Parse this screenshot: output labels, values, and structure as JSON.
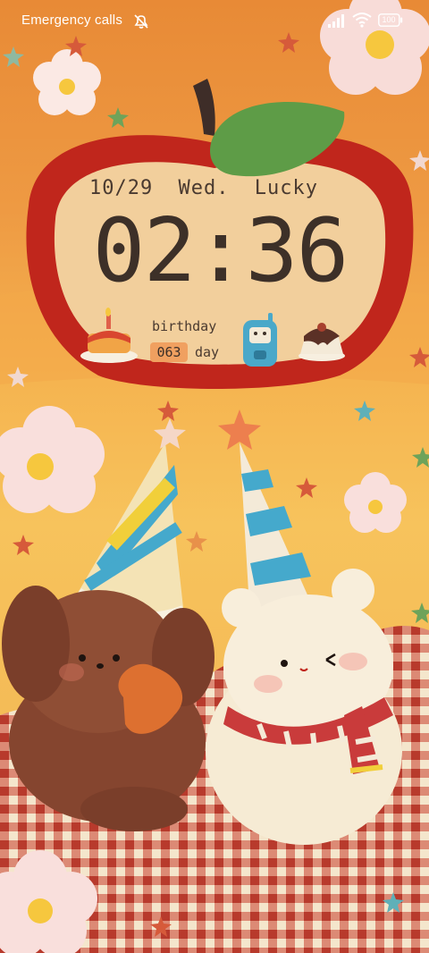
{
  "status_bar": {
    "carrier_text": "Emergency calls",
    "battery_level": "100",
    "icons": [
      "alarm-off-icon",
      "signal-icon",
      "wifi-icon",
      "battery-icon"
    ]
  },
  "lock_widget": {
    "date": "10/29",
    "weekday": "Wed.",
    "mood": "Lucky",
    "time": "02:36",
    "event_label": "birthday",
    "day_count": "063",
    "day_unit": "day",
    "icons": [
      "cake-icon",
      "phone-icon",
      "pudding-icon"
    ]
  },
  "wallpaper": {
    "colors": {
      "apple_red": "#c0261c",
      "apple_face": "#f2cf9c",
      "leaf": "#5e9c47",
      "sky_top": "#e88a36",
      "sky_bottom": "#f7c35c",
      "tablecloth": "#c24a3a"
    }
  }
}
